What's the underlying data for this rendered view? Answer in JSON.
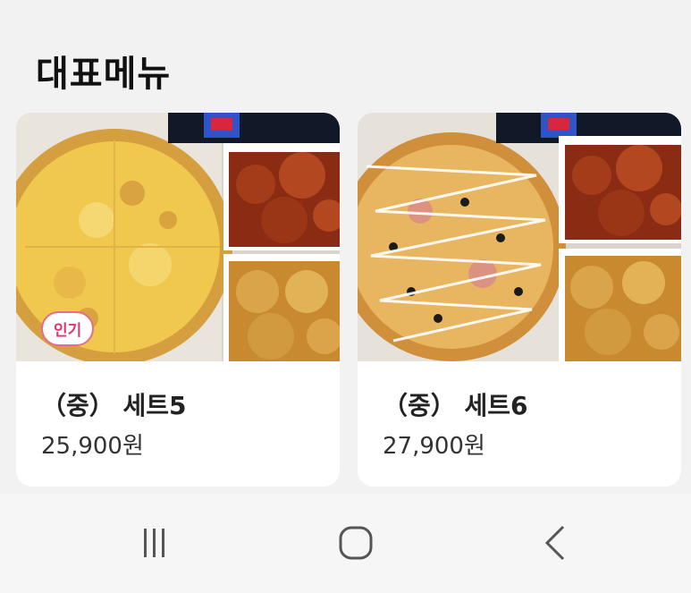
{
  "section": {
    "title": "대표메뉴"
  },
  "menu": [
    {
      "name": "（중） 세트5",
      "price": "25,900원",
      "badge": "인기",
      "image": "pizza-with-chicken-set-photo"
    },
    {
      "name": "（중） 세트6",
      "price": "27,900원",
      "badge": "",
      "image": "pizza-with-chicken-set-photo"
    }
  ],
  "navbar": {
    "icons": [
      "recent-apps-icon",
      "home-icon",
      "back-icon"
    ]
  },
  "colors": {
    "badge_border": "#e86a8d",
    "badge_text": "#e2356c",
    "card_bg": "#ffffff",
    "page_bg": "#f2f2f2"
  }
}
